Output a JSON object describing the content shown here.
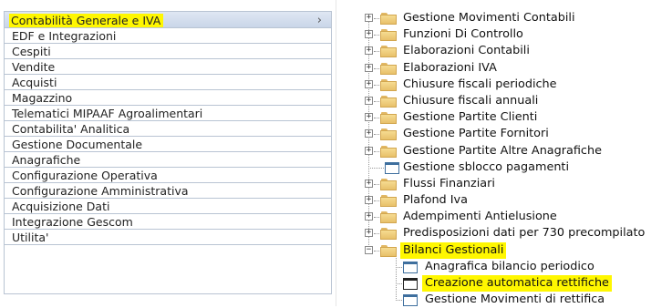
{
  "left_menu": {
    "selected": "Contabilità Generale e IVA",
    "chevron": "›",
    "items": [
      "EDF e Integrazioni",
      "Cespiti",
      "Vendite",
      "Acquisti",
      "Magazzino",
      "Telematici MIPAAF Agroalimentari",
      "Contabilita' Analitica",
      "Gestione Documentale",
      "Anagrafiche",
      "Configurazione Operativa",
      "Configurazione Amministrativa",
      "Acquisizione Dati",
      "Integrazione Gescom",
      "Utilita'"
    ]
  },
  "tree": {
    "nodes": [
      "Gestione Movimenti Contabili",
      "Funzioni Di Controllo",
      "Elaborazioni Contabili",
      "Elaborazioni IVA",
      "Chiusure fiscali periodiche",
      "Chiusure fiscali annuali",
      "Gestione Partite Clienti",
      "Gestione Partite Fornitori",
      "Gestione Partite Altre Anagrafiche",
      "Gestione sblocco pagamenti",
      "Flussi Finanziari",
      "Plafond Iva",
      "Adempimenti Antielusione",
      "Predisposizioni dati per 730 precompilato",
      "Bilanci Gestionali"
    ],
    "children": [
      "Anagrafica bilancio periodico",
      "Creazione automatica rettifiche",
      "Gestione Movimenti di rettifica"
    ],
    "expand_symbol": "+",
    "collapse_symbol": "−"
  },
  "colors": {
    "highlight": "#fff700",
    "folder": "#e8c06a",
    "selected_row": "#c9d6e8"
  }
}
